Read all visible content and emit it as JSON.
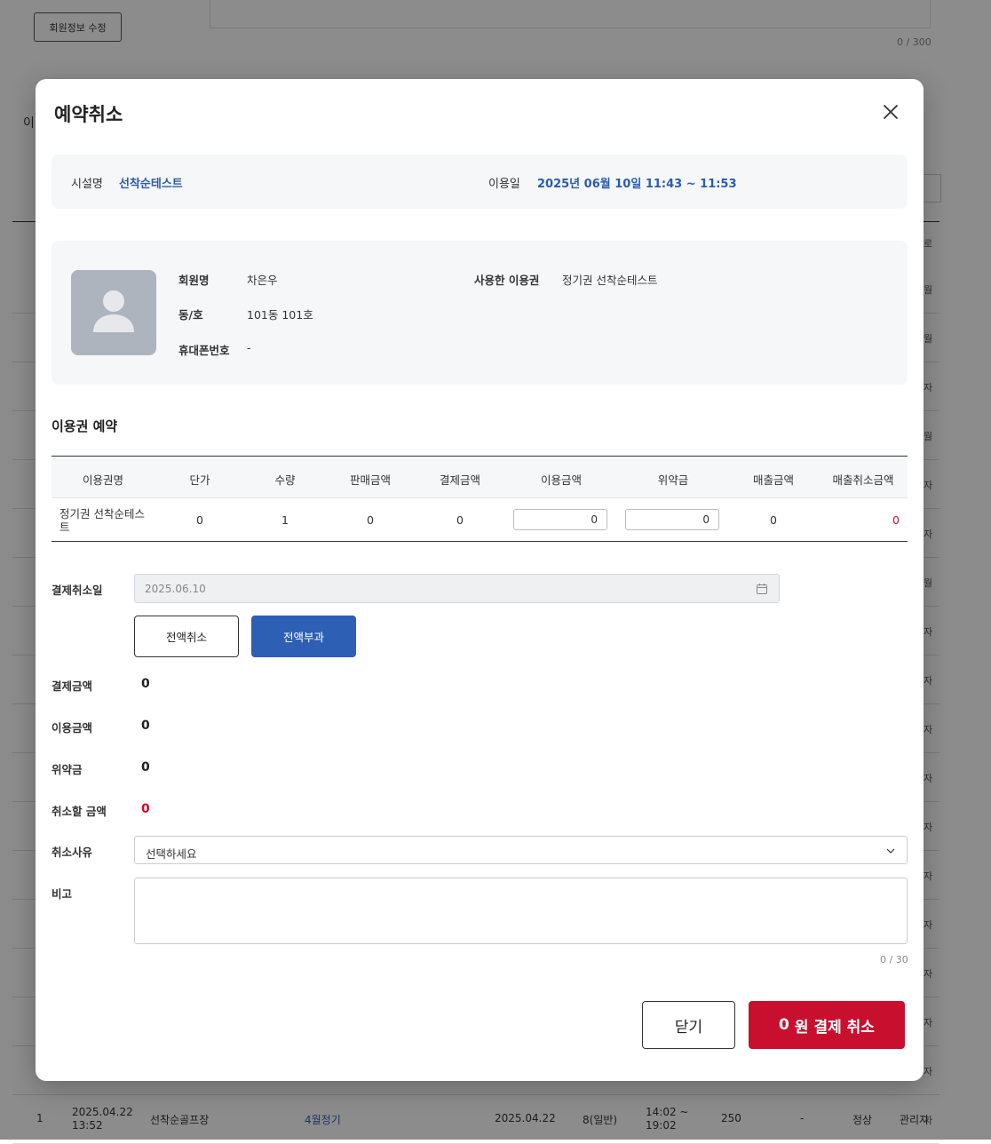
{
  "background": {
    "edit_member_button": "회원정보 수정",
    "memo_counter": "0 / 300",
    "side_label": "이",
    "right_header": "로",
    "right_cells": [
      "월",
      "월",
      "자",
      "월",
      "자",
      "자",
      "월",
      "자",
      "자",
      "자",
      "자",
      "자",
      "자",
      "자",
      "자",
      "자",
      "자",
      "자"
    ],
    "bottom_row": {
      "no": "1",
      "datetime": "2025.04.22\n13:52",
      "facility": "선착순골프장",
      "ticket": "4월정기",
      "use_date": "2025.04.22",
      "slot": "8(일반)",
      "time": "14:02 ~\n19:02",
      "amount": "250",
      "dash": "-",
      "status": "정상",
      "by": "관리자"
    }
  },
  "modal": {
    "title": "예약취소",
    "info": {
      "facility_label": "시설명",
      "facility_value": "선착순테스트",
      "date_label": "이용일",
      "date_value": "2025년 06월 10일 11:43 ~ 11:53"
    },
    "member": {
      "name_label": "회원명",
      "name_value": "차은우",
      "unit_label": "동/호",
      "unit_value": "101동 101호",
      "phone_label": "휴대폰번호",
      "phone_value": "-",
      "ticket_label": "사용한 이용권",
      "ticket_value": "정기권 선착순테스트"
    },
    "section_title": "이용권 예약",
    "table": {
      "headers": [
        "이용권명",
        "단가",
        "수량",
        "판매금액",
        "결제금액",
        "이용금액",
        "위약금",
        "매출금액",
        "매출취소금액"
      ],
      "row": {
        "name": "정기권 선착순테스트",
        "unit_price": "0",
        "quantity": "1",
        "sale_amount": "0",
        "paid_amount": "0",
        "usage_amount": "0",
        "penalty": "0",
        "revenue": "0",
        "revenue_cancel": "0"
      }
    },
    "form": {
      "cancel_date_label": "결제취소일",
      "cancel_date_value": "2025.06.10",
      "full_cancel_button": "전액취소",
      "full_charge_button": "전액부과",
      "paid_label": "결제금액",
      "paid_value": "0",
      "usage_label": "이용금액",
      "usage_value": "0",
      "penalty_label": "위약금",
      "penalty_value": "0",
      "refund_label": "취소할 금액",
      "refund_value": "0",
      "reason_label": "취소사유",
      "reason_placeholder": "선택하세요",
      "memo_label": "비고",
      "memo_counter": "0 / 30"
    },
    "footer": {
      "close_button": "닫기",
      "cancel_amount": "0",
      "cancel_suffix": "원 결제 취소"
    }
  },
  "colors": {
    "accent_blue": "#2d5fb5",
    "danger_red": "#c8102e",
    "info_value_blue": "#2b5bb0"
  }
}
